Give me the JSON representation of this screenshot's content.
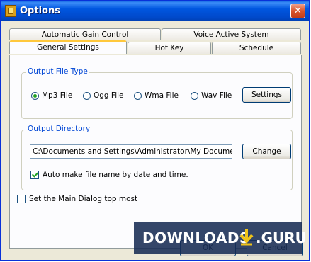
{
  "window": {
    "title": "Options",
    "close_glyph": "✕"
  },
  "tabs": {
    "row1": [
      "Automatic Gain Control",
      "Voice Active System"
    ],
    "row2": [
      "General Settings",
      "Hot Key",
      "Schedule"
    ],
    "active": "General Settings"
  },
  "output_file_type": {
    "label": "Output File Type",
    "options": [
      "Mp3 File",
      "Ogg File",
      "Wma File",
      "Wav File"
    ],
    "selected": "Mp3 File",
    "settings_button": "Settings"
  },
  "output_directory": {
    "label": "Output Directory",
    "path": "C:\\Documents and Settings\\Administrator\\My Documents\\M",
    "change_button": "Change",
    "auto_name_label": "Auto make file name by date and time.",
    "auto_name_checked": true
  },
  "top_most": {
    "label": "Set the Main Dialog top most",
    "checked": false
  },
  "buttons": {
    "ok": "OK",
    "cancel": "Cancel"
  },
  "watermark": {
    "text": "DOWNLOADS",
    "suffix": ".GURU"
  }
}
